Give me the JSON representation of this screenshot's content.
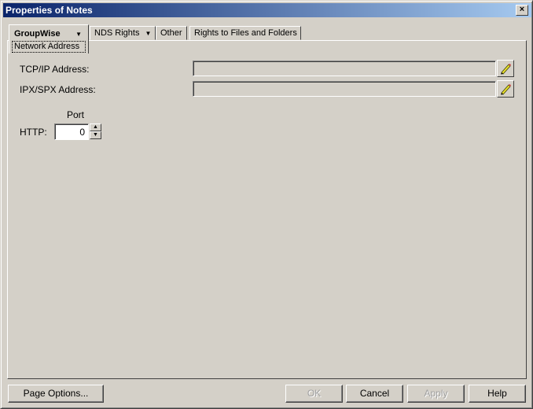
{
  "window": {
    "title": "Properties of Notes",
    "close_label": "×"
  },
  "tabs": [
    {
      "label": "GroupWise",
      "sub_label": "Network Address",
      "has_dropdown": true,
      "active": true
    },
    {
      "label": "NDS Rights",
      "has_dropdown": true
    },
    {
      "label": "Other"
    },
    {
      "label": "Rights to Files and Folders"
    }
  ],
  "form": {
    "tcpip_label": "TCP/IP Address:",
    "tcpip_value": "",
    "ipxspx_label": "IPX/SPX Address:",
    "ipxspx_value": "",
    "port_header": "Port",
    "http_label": "HTTP:",
    "http_port": "0"
  },
  "buttons": {
    "page_options": "Page Options...",
    "ok": "OK",
    "cancel": "Cancel",
    "apply": "Apply",
    "help": "Help"
  },
  "icons": {
    "edit": "pencil-icon",
    "dropdown": "triangle-down",
    "spin_up": "▲",
    "spin_down": "▼"
  }
}
